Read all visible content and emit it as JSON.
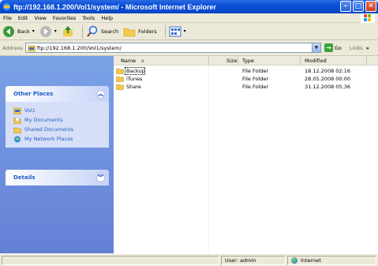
{
  "window": {
    "title": "ftp://192.168.1.200/Vol1/system/ - Microsoft Internet Explorer",
    "minimize": "–",
    "maximize": "□",
    "close": "✕"
  },
  "menu": [
    "File",
    "Edit",
    "View",
    "Favorites",
    "Tools",
    "Help"
  ],
  "toolbar": {
    "back_label": "Back",
    "search_label": "Search",
    "folders_label": "Folders"
  },
  "address": {
    "label": "Address",
    "value": "ftp://192.168.1.200/Vol1/system/",
    "go_label": "Go",
    "links_label": "Links",
    "more": "»"
  },
  "sidebar": {
    "other_places": {
      "title": "Other Places",
      "items": [
        {
          "label": "Vol1",
          "icon": "ftp-folder-icon"
        },
        {
          "label": "My Documents",
          "icon": "my-documents-icon"
        },
        {
          "label": "Shared Documents",
          "icon": "shared-documents-icon"
        },
        {
          "label": "My Network Places",
          "icon": "network-places-icon"
        }
      ],
      "toggle": "︽"
    },
    "details": {
      "title": "Details",
      "toggle": "︾"
    }
  },
  "files": {
    "columns": {
      "name": "Name",
      "sort": "▲",
      "size": "Size",
      "type": "Type",
      "modified": "Modified"
    },
    "rows": [
      {
        "name": "Backup",
        "size": "",
        "type": "File Folder",
        "modified": "18.12.2008 02:16"
      },
      {
        "name": "iTunes",
        "size": "",
        "type": "File Folder",
        "modified": "28.05.2008 00:00"
      },
      {
        "name": "Share",
        "size": "",
        "type": "File Folder",
        "modified": "31.12.2008 05:36"
      }
    ]
  },
  "status": {
    "user": "User: admin",
    "zone": "Internet"
  },
  "colors": {
    "title_bar": "#0a4fd8",
    "sidebar_bg": "#6f8fdd",
    "panel_body": "#d6dff7",
    "link_text": "#215dc6",
    "folder": "#f2c94c"
  }
}
